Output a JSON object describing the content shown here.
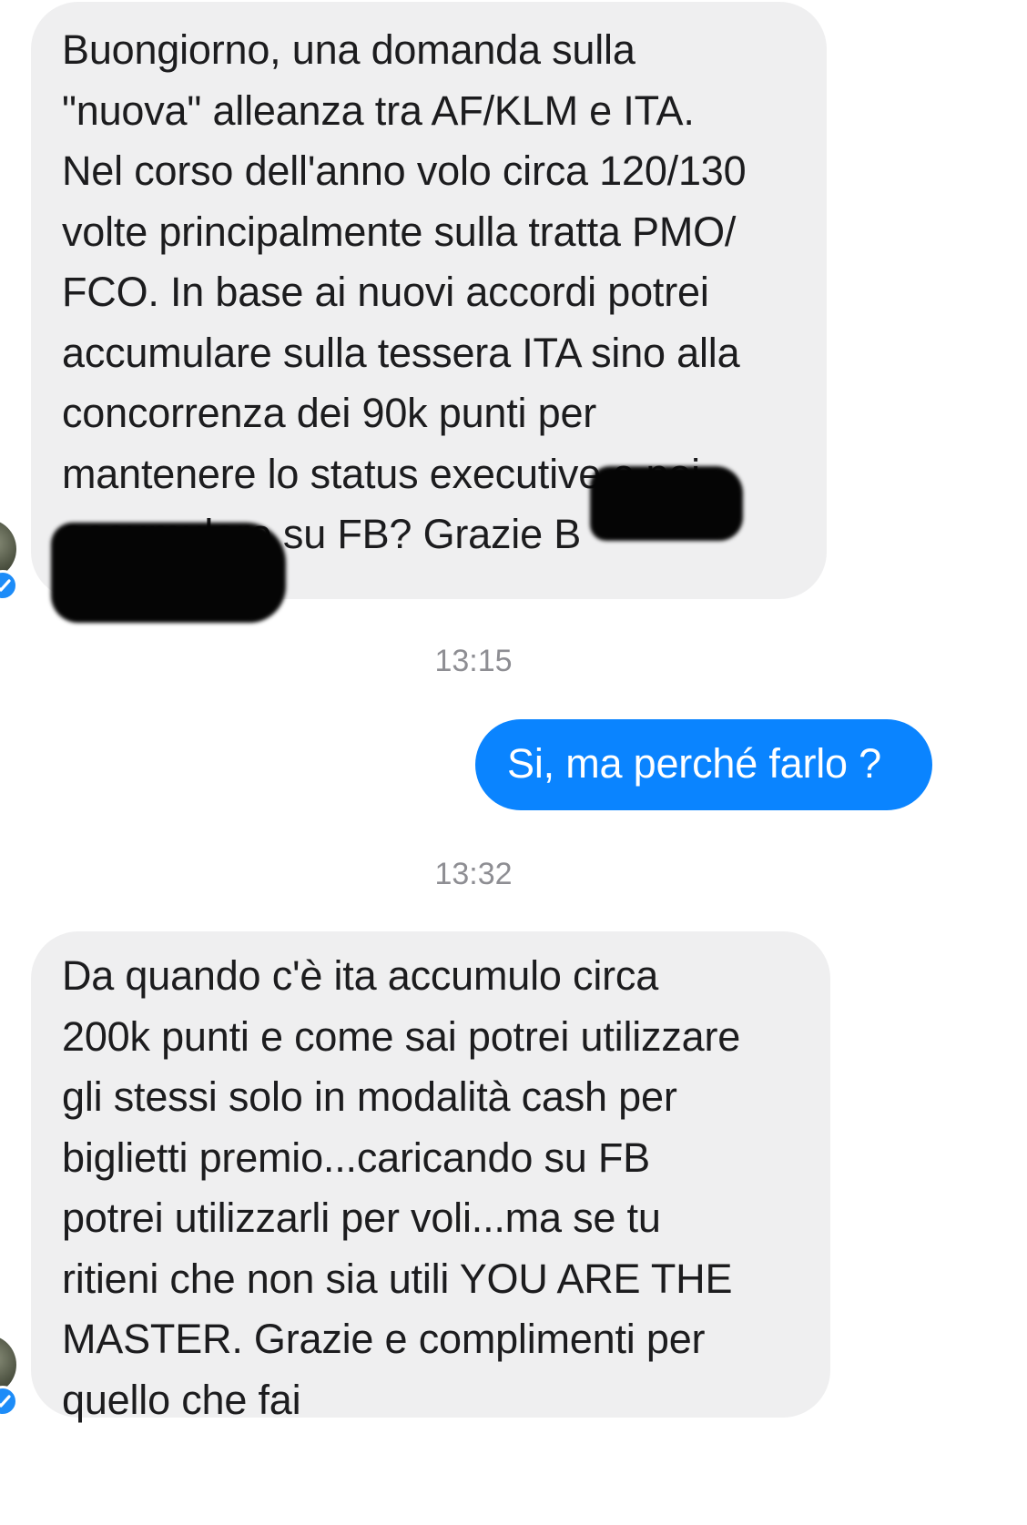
{
  "conversation": {
    "messages": [
      {
        "direction": "incoming",
        "text": "Buongiorno, una domanda sulla\n\"nuova\" alleanza tra AF/KLM e ITA.\nNel corso dell'anno volo circa 120/130\nvolte principalmente sulla tratta PMO/\nFCO. In base ai nuovi accordi potrei\naccumulare sulla tessera ITA sino alla\nconcorrenza dei 90k punti per\nmantenere lo status executive  e poi\naccumulare su FB? Grazie  B"
      },
      {
        "direction": "outgoing",
        "text": "Si, ma perché farlo ?"
      },
      {
        "direction": "incoming",
        "text": "Da quando c'è ita accumulo circa\n200k punti e come sai potrei utilizzare\ngli stessi solo in modalità cash per\nbiglietti premio...caricando su FB\npotrei utilizzarli per voli...ma se tu\nritieni che non sia utili YOU ARE THE\nMASTER. Grazie e complimenti per\nquello che fai"
      }
    ],
    "timestamps": [
      "13:15",
      "13:32"
    ]
  },
  "icons": {
    "avatar": "avatar-photo",
    "verified": "verified-check-icon"
  },
  "colors": {
    "incoming_bubble": "#efeff0",
    "outgoing_bubble": "#0a84ff",
    "timestamp_text": "#8e8e93",
    "verified_badge": "#1d8cf8"
  }
}
